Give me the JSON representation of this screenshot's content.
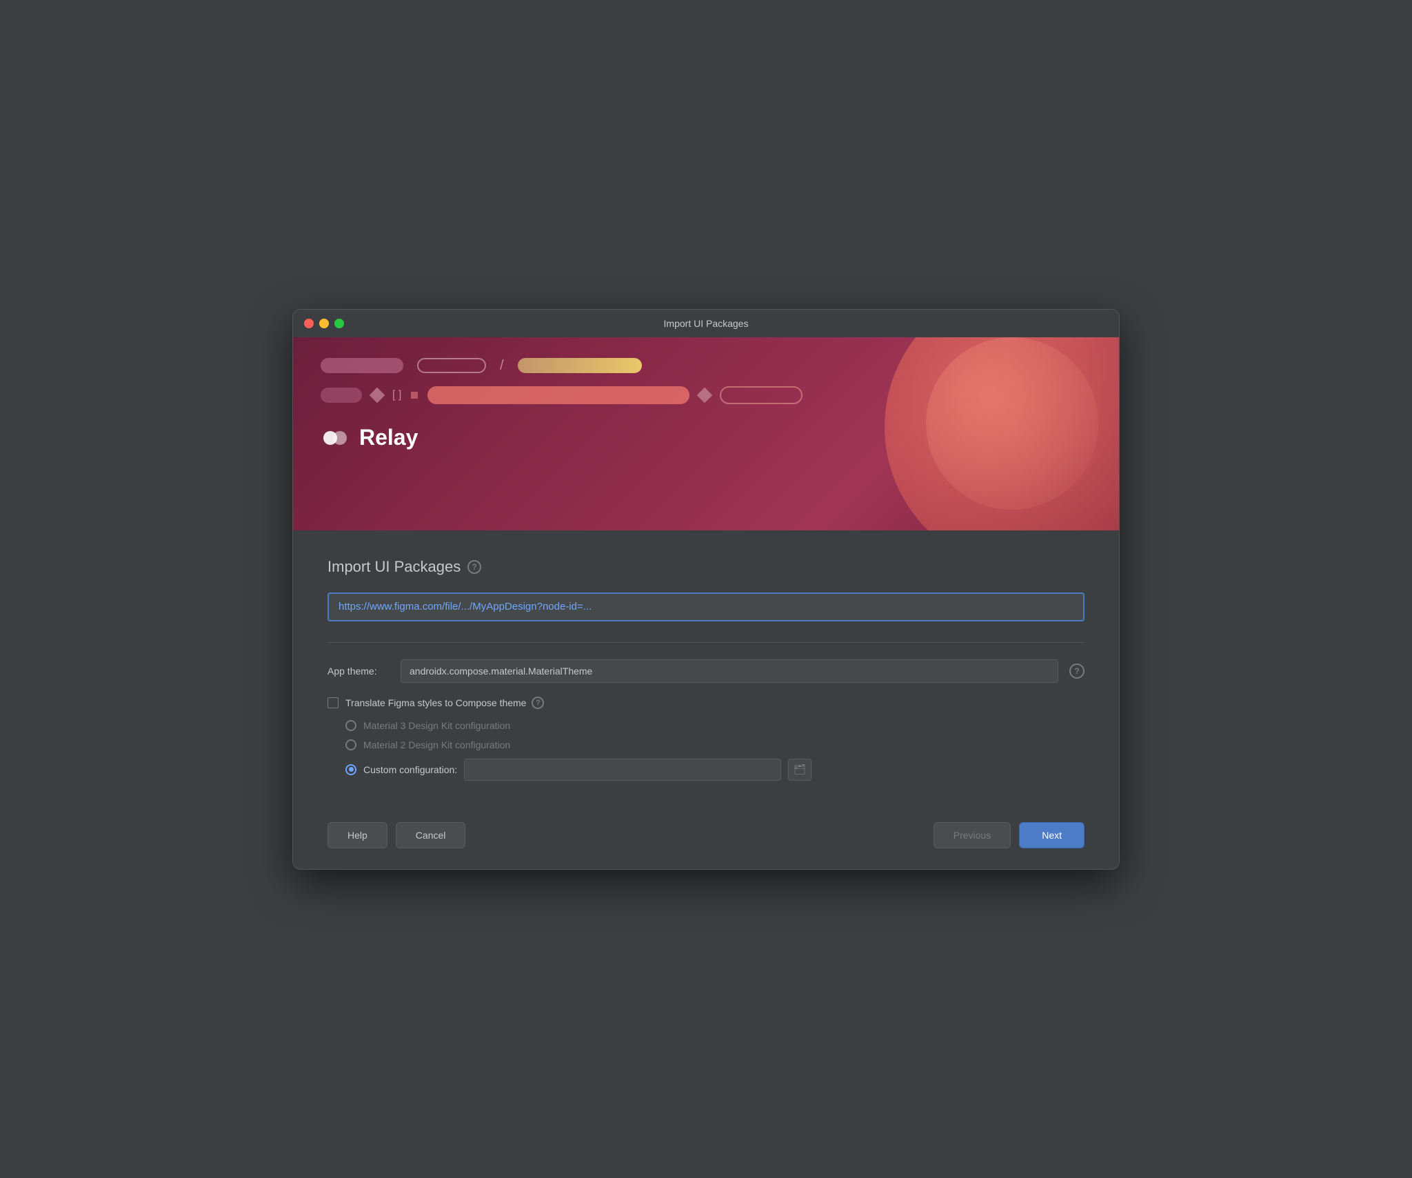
{
  "window": {
    "title": "Import UI Packages"
  },
  "hero": {
    "logo_text": "Relay",
    "decorative_rows": [
      {
        "pill1_width": 120,
        "pill2_width": 100,
        "pill3_width": 180
      }
    ]
  },
  "main": {
    "section_title": "Import UI Packages",
    "help_label": "?",
    "url_placeholder": "https://www.figma.com/file/.../MyAppDesign?node-id=...",
    "url_value": "https://www.figma.com/file/.../MyAppDesign?node-id=...",
    "app_theme_label": "App theme:",
    "app_theme_value": "androidx.compose.material.MaterialTheme",
    "app_theme_help": "?",
    "translate_checkbox_label": "Translate Figma styles to Compose theme",
    "translate_help": "?",
    "radio_options": [
      {
        "label": "Material 3 Design Kit configuration",
        "selected": false
      },
      {
        "label": "Material 2 Design Kit configuration",
        "selected": false
      },
      {
        "label": "Custom configuration:",
        "selected": true
      }
    ],
    "custom_config_placeholder": ""
  },
  "footer": {
    "help_label": "Help",
    "cancel_label": "Cancel",
    "previous_label": "Previous",
    "next_label": "Next"
  },
  "icons": {
    "folder": "🗂",
    "question": "?"
  }
}
